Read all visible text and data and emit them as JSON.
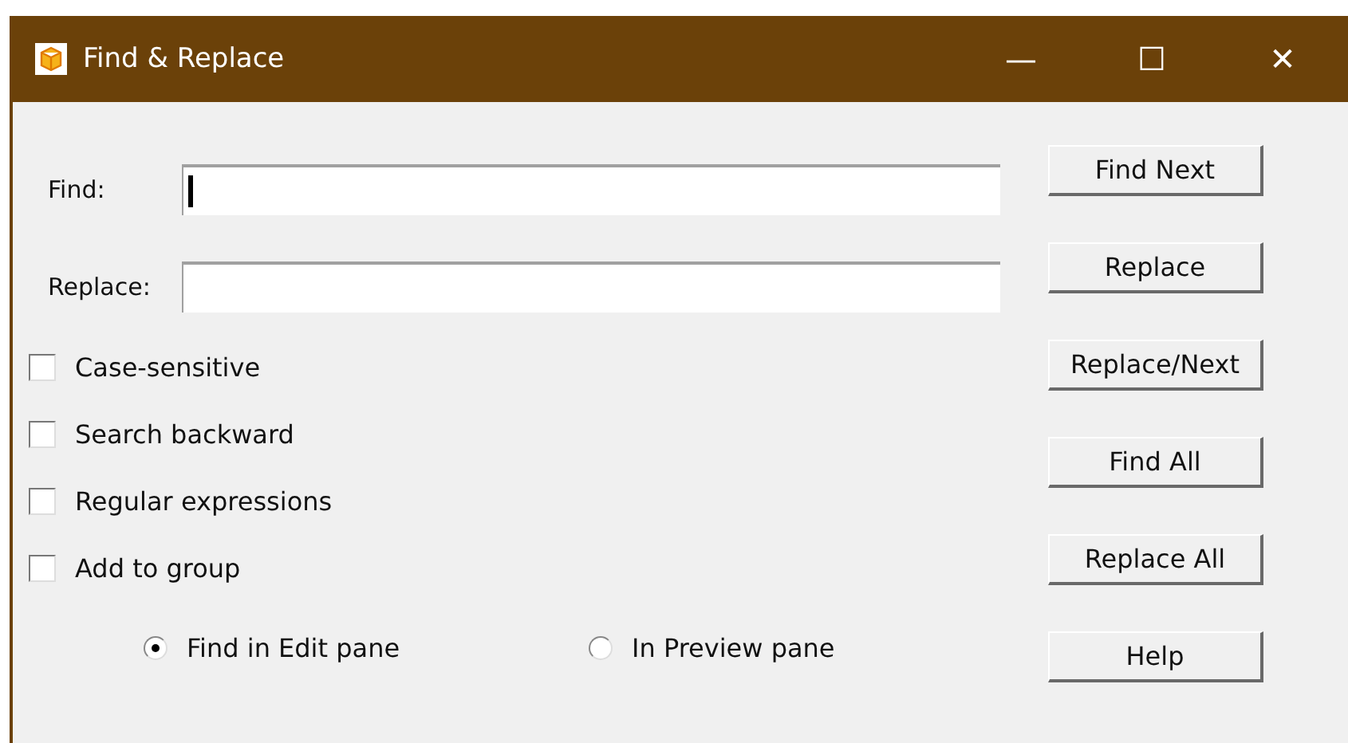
{
  "window": {
    "title": "Find & Replace",
    "controls": [
      "—",
      "☐",
      "✕"
    ]
  },
  "fields": [
    {
      "label": "Find:",
      "focused": true
    },
    {
      "label": "Replace:",
      "focused": false
    }
  ],
  "options": [
    {
      "label": "Case-sensitive",
      "checked": false
    },
    {
      "label": "Search backward",
      "checked": false
    },
    {
      "label": "Regular expressions",
      "checked": false
    },
    {
      "label": "Add to group",
      "checked": false
    }
  ],
  "scope": [
    {
      "label": "Find in Edit pane",
      "selected": true
    },
    {
      "label": "In Preview pane",
      "selected": false
    }
  ],
  "buttons": [
    "Find Next",
    "Replace",
    "Replace/Next",
    "Find All",
    "Replace All",
    "Help"
  ]
}
